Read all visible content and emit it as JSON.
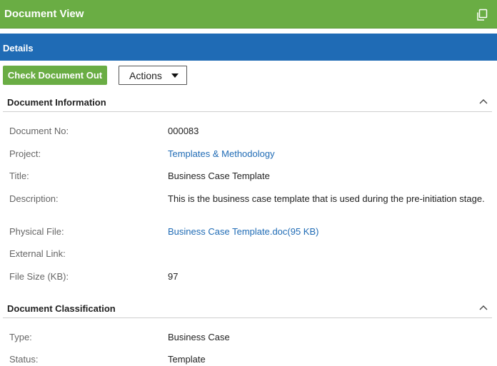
{
  "header": {
    "title": "Document View",
    "icon": "copy-icon"
  },
  "details_bar": {
    "label": "Details"
  },
  "toolbar": {
    "check_out_label": "Check Document Out",
    "actions_label": "Actions"
  },
  "sections": {
    "info": {
      "title": "Document Information",
      "rows": {
        "doc_no": {
          "label": "Document No:",
          "value": "000083"
        },
        "project": {
          "label": "Project:",
          "value": "Templates & Methodology"
        },
        "title": {
          "label": "Title:",
          "value": "Business Case Template"
        },
        "description": {
          "label": "Description:",
          "value": "This is the business case template that is used during the pre-initiation stage."
        },
        "physical_file": {
          "label": "Physical File:",
          "value": "Business Case Template.doc(95 KB)"
        },
        "external_link": {
          "label": "External Link:",
          "value": ""
        },
        "file_size": {
          "label": "File Size (KB):",
          "value": "97"
        }
      }
    },
    "classification": {
      "title": "Document Classification",
      "rows": {
        "type": {
          "label": "Type:",
          "value": "Business Case"
        },
        "status": {
          "label": "Status:",
          "value": "Template"
        }
      }
    }
  },
  "colors": {
    "header_green": "#6aad44",
    "details_blue": "#1f6bb5",
    "link_blue": "#1f6bb5"
  }
}
